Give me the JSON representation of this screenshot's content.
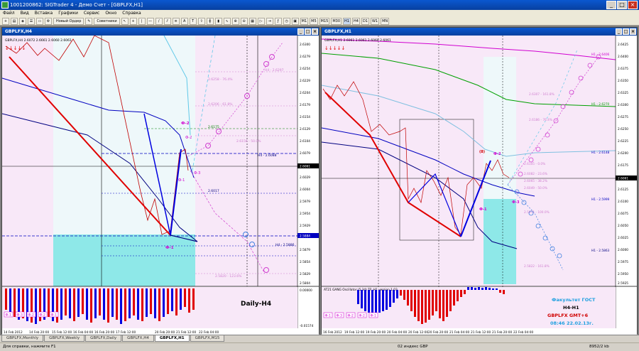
{
  "app": {
    "title": "1001200862: SIGTrader 4 - Демо Счет - [GBPLFX,H1]"
  },
  "menu": [
    "Файл",
    "Вид",
    "Вставка",
    "Графики",
    "Сервис",
    "Окно",
    "Справка"
  ],
  "toolbar": {
    "new_order": "Новый Ордер",
    "advisors": "Советники",
    "timeframes": [
      "M1",
      "M5",
      "M15",
      "M30",
      "H1",
      "H4",
      "D1",
      "W1",
      "MN"
    ]
  },
  "left_chart": {
    "window_title": "GBPLFX,H4",
    "info": "GBPLFX,H4 2.6072 2.6661 2.6060 2.6061",
    "price_labels": [
      "2.6300",
      "2.6279",
      "2.6254",
      "2.6229",
      "2.6204",
      "2.6179",
      "2.6154",
      "2.6129",
      "2.6104",
      "2.6079",
      "2.6054",
      "2.6029",
      "2.6004",
      "2.5979",
      "2.5954",
      "2.5929",
      "2.5904",
      "2.5879",
      "2.5854",
      "2.5829",
      "2.5804"
    ],
    "current_price": "2.6061",
    "blue_price": "2.5884",
    "time_labels": [
      "14 Feb 2012",
      "14 Feb 20:00",
      "15 Feb 12:00",
      "16 Feb 04:00",
      "16 Feb 20:00",
      "17 Feb 12:00",
      "20 Feb 20:00",
      "21 Feb 12:00",
      "22 Feb 04:00"
    ],
    "fib_labels": [
      "H4 - 2.6297",
      "2.6258 - 76.4%",
      "2.6206 - 61.8%",
      "2.6175",
      "2.6156 - 50.0%",
      "H4 - 2.6088",
      "2.6017",
      "H4 - 2.5886",
      "2.5820 - 123.6%"
    ],
    "wave_labels": [
      "Ф-2",
      "Ф-2",
      "Ф-1",
      "Ф-3",
      "Ф-1"
    ],
    "indicator_boxes": [
      "Ф-1",
      "Ф-3",
      "Ф-2",
      "Ф-2",
      "Ф-1"
    ],
    "indicator_levels": [
      "0.00000",
      "-0.01574"
    ],
    "overlay_label": "Daily-H4"
  },
  "right_chart": {
    "window_title": "GBPLFX,H1",
    "info": "GBPLFX,H1 2.6061 2.6061 2.6060 2.6061",
    "price_labels": [
      "2.6425",
      "2.6400",
      "2.6375",
      "2.6350",
      "2.6325",
      "2.6300",
      "2.6275",
      "2.6250",
      "2.6225",
      "2.6200",
      "2.6175",
      "2.6150",
      "2.6125",
      "2.6100",
      "2.6075",
      "2.6050",
      "2.6025",
      "2.6000",
      "2.5975",
      "2.5950",
      "2.5925"
    ],
    "current_price": "2.6061",
    "time_labels": [
      "16 Feb 2012",
      "19 Feb 12:00",
      "19 Feb 20:00",
      "20 Feb 04:00",
      "20 Feb 12:00",
      "20 Feb 20:00",
      "21 Feb 04:00",
      "21 Feb 12:00",
      "21 Feb 20:00",
      "22 Feb 04:00"
    ],
    "fib_labels": [
      "H1 - 2.6406",
      "2.6307 - 161.8%",
      "H1 - 2.6270",
      "2.6186 - 76.4%",
      "H1 - 2.6148",
      "2.6105 - 0.0%",
      "2.6082 - 23.6%",
      "2.6065 - 38.2%",
      "2.6049 - 50.0%",
      "H1 - 2.5999",
      "2.5971 - 100.0%",
      "H1 - 2.5863",
      "2.5822 - 161.8%"
    ],
    "wave_labels": [
      "(8)",
      "Ф-2",
      "Ф-1",
      "Ф-3"
    ],
    "indicator_boxes": [
      "Ф-1",
      "Ф-3",
      "Ф-2",
      "Ф-2",
      "Ф-1"
    ],
    "indicator_title": "AT21 GANG Oscillator (5,34) TF: H1 version 1.03",
    "overlay": {
      "line1": "Факультет ГОСТ",
      "line2": "H4-H1",
      "line3": "GBPLFX   GMT+6",
      "line4": "08:46 22.02.13г."
    }
  },
  "tabs": [
    "GBPLFX,Monthly",
    "GBPLFX,Weekly",
    "GBPLFX,Daily",
    "GBPLFX,H4",
    "GBPLFX,H1",
    "GBPLFX,M15"
  ],
  "active_tab": "GBPLFX,H1",
  "status": {
    "help": "Для справки, нажмите F1",
    "profile": "02 индекс GBP",
    "traffic": "8952/2 kb"
  },
  "colors": {
    "chart_bg": "#f8e8f8",
    "cyan_zone": "#8ee8e8",
    "bear_line": "#e00000",
    "blue_line": "#0000c0",
    "fib_magenta": "#d040d0"
  }
}
